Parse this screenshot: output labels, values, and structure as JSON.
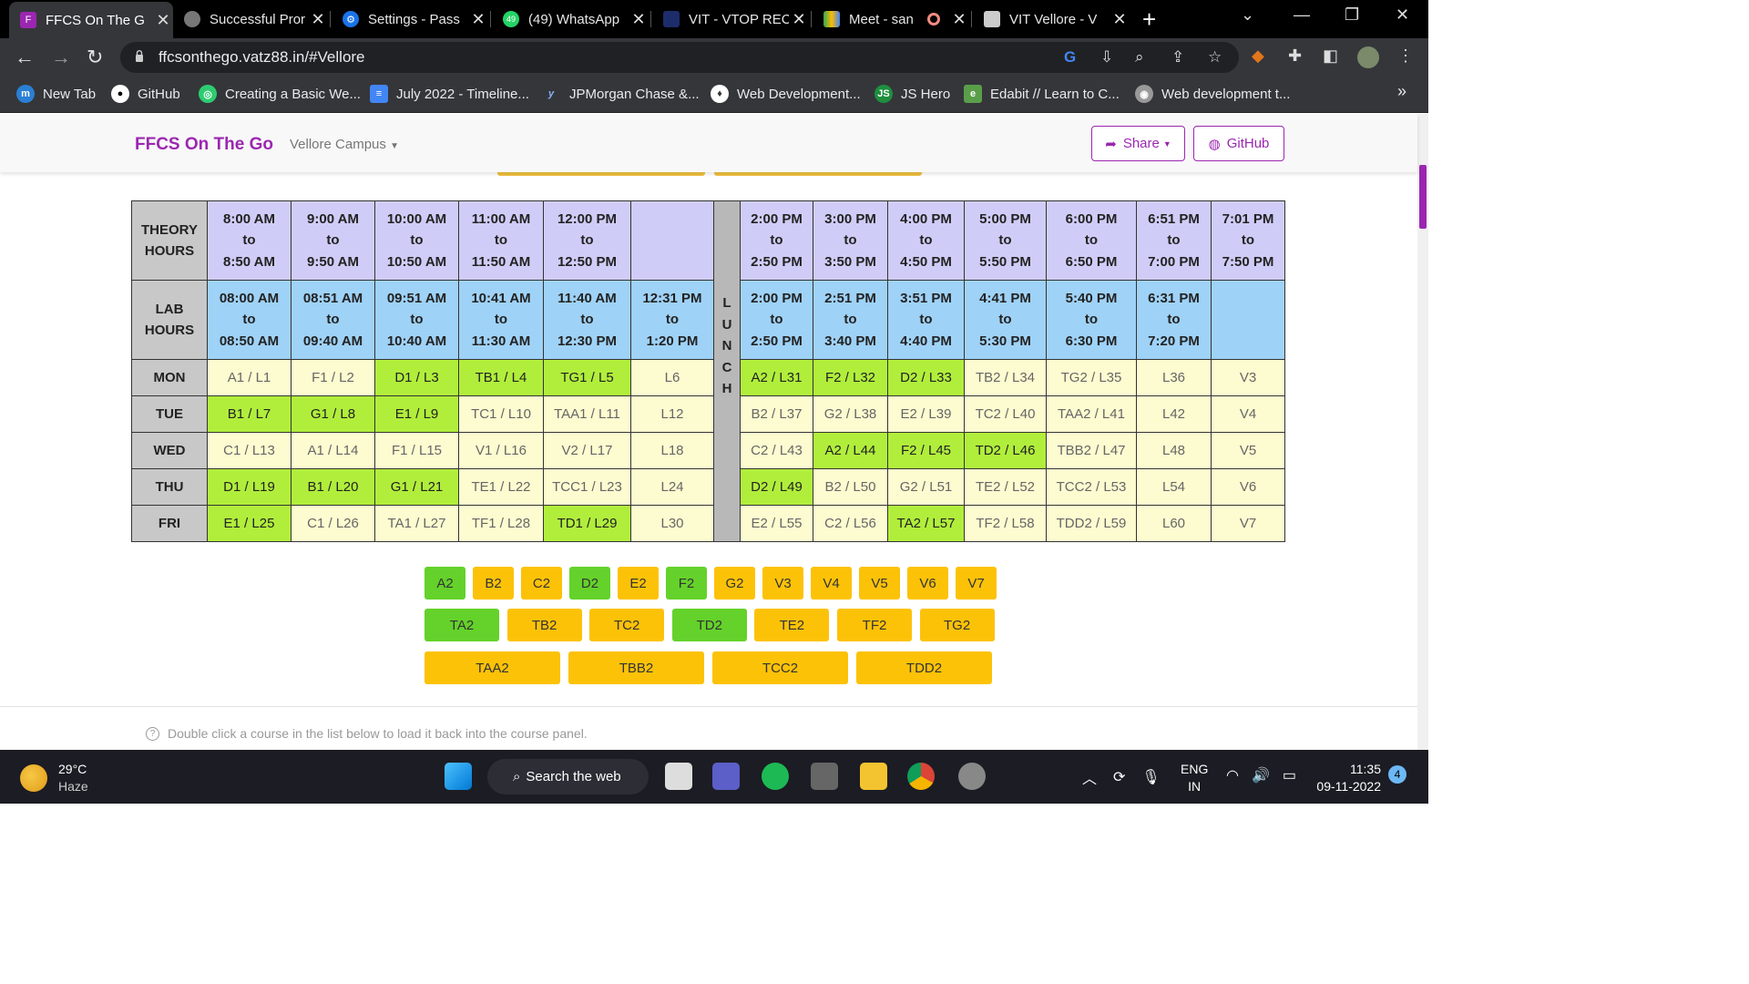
{
  "browser": {
    "tabs": [
      {
        "title": "FFCS On The G",
        "active": true
      },
      {
        "title": "Successful Pror",
        "active": false
      },
      {
        "title": "Settings - Pass",
        "active": false
      },
      {
        "title": "(49) WhatsApp",
        "active": false
      },
      {
        "title": "VIT - VTOP REC",
        "active": false
      },
      {
        "title": "Meet - san",
        "active": false
      },
      {
        "title": "VIT Vellore - V",
        "active": false
      }
    ],
    "whatsapp_badge": "49",
    "url": "ffcsonthego.vatz88.in/#Vellore",
    "bookmarks": [
      {
        "label": "New Tab",
        "icon": "m"
      },
      {
        "label": "GitHub",
        "icon": "github-icon"
      },
      {
        "label": "Creating a Basic We...",
        "icon": "swirl-icon"
      },
      {
        "label": "July 2022 - Timeline...",
        "icon": "doc-icon"
      },
      {
        "label": "JPMorgan Chase &...",
        "icon": "yello-icon"
      },
      {
        "label": "Web Development...",
        "icon": "bulb-icon"
      },
      {
        "label": "JS Hero",
        "icon": "js-icon"
      },
      {
        "label": "Edabit // Learn to C...",
        "icon": "edabit-icon"
      },
      {
        "label": "Web development t...",
        "icon": "globe-icon"
      }
    ],
    "bookmarks_overflow": "»"
  },
  "site": {
    "brand": "FFCS On The Go",
    "campus": "Vellore Campus",
    "share_label": "Share",
    "github_label": "GitHub"
  },
  "timetable": {
    "theory_label": [
      "THEORY",
      "HOURS"
    ],
    "lab_label": [
      "LAB",
      "HOURS"
    ],
    "lunch": [
      "L",
      "U",
      "N",
      "C",
      "H"
    ],
    "theory_hours": [
      [
        "8:00 AM",
        "to",
        "8:50 AM"
      ],
      [
        "9:00 AM",
        "to",
        "9:50 AM"
      ],
      [
        "10:00 AM",
        "to",
        "10:50 AM"
      ],
      [
        "11:00 AM",
        "to",
        "11:50 AM"
      ],
      [
        "12:00 PM",
        "to",
        "12:50 PM"
      ],
      [
        "",
        "",
        ""
      ],
      [
        "2:00 PM",
        "to",
        "2:50 PM"
      ],
      [
        "3:00 PM",
        "to",
        "3:50 PM"
      ],
      [
        "4:00 PM",
        "to",
        "4:50 PM"
      ],
      [
        "5:00 PM",
        "to",
        "5:50 PM"
      ],
      [
        "6:00 PM",
        "to",
        "6:50 PM"
      ],
      [
        "6:51 PM",
        "to",
        "7:00 PM"
      ],
      [
        "7:01 PM",
        "to",
        "7:50 PM"
      ]
    ],
    "lab_hours": [
      [
        "08:00 AM",
        "to",
        "08:50 AM"
      ],
      [
        "08:51 AM",
        "to",
        "09:40 AM"
      ],
      [
        "09:51 AM",
        "to",
        "10:40 AM"
      ],
      [
        "10:41 AM",
        "to",
        "11:30 AM"
      ],
      [
        "11:40 AM",
        "to",
        "12:30 PM"
      ],
      [
        "12:31 PM",
        "to",
        "1:20 PM"
      ],
      [
        "2:00 PM",
        "to",
        "2:50 PM"
      ],
      [
        "2:51 PM",
        "to",
        "3:40 PM"
      ],
      [
        "3:51 PM",
        "to",
        "4:40 PM"
      ],
      [
        "4:41 PM",
        "to",
        "5:30 PM"
      ],
      [
        "5:40 PM",
        "to",
        "6:30 PM"
      ],
      [
        "6:31 PM",
        "to",
        "7:20 PM"
      ],
      [
        "",
        "",
        ""
      ]
    ],
    "days": [
      {
        "day": "MON",
        "slots": [
          {
            "t": "A1 / L1",
            "sel": false
          },
          {
            "t": "F1 / L2",
            "sel": false
          },
          {
            "t": "D1 / L3",
            "sel": true
          },
          {
            "t": "TB1 / L4",
            "sel": true
          },
          {
            "t": "TG1 / L5",
            "sel": true
          },
          {
            "t": "L6",
            "sel": false
          },
          {
            "t": "A2 / L31",
            "sel": true
          },
          {
            "t": "F2 / L32",
            "sel": true
          },
          {
            "t": "D2 / L33",
            "sel": true
          },
          {
            "t": "TB2 / L34",
            "sel": false
          },
          {
            "t": "TG2 / L35",
            "sel": false
          },
          {
            "t": "L36",
            "sel": false
          },
          {
            "t": "V3",
            "sel": false
          }
        ]
      },
      {
        "day": "TUE",
        "slots": [
          {
            "t": "B1 / L7",
            "sel": true
          },
          {
            "t": "G1 / L8",
            "sel": true
          },
          {
            "t": "E1 / L9",
            "sel": true
          },
          {
            "t": "TC1 / L10",
            "sel": false
          },
          {
            "t": "TAA1 / L11",
            "sel": false
          },
          {
            "t": "L12",
            "sel": false
          },
          {
            "t": "B2 / L37",
            "sel": false
          },
          {
            "t": "G2 / L38",
            "sel": false
          },
          {
            "t": "E2 / L39",
            "sel": false
          },
          {
            "t": "TC2 / L40",
            "sel": false
          },
          {
            "t": "TAA2 / L41",
            "sel": false
          },
          {
            "t": "L42",
            "sel": false
          },
          {
            "t": "V4",
            "sel": false
          }
        ]
      },
      {
        "day": "WED",
        "slots": [
          {
            "t": "C1 / L13",
            "sel": false
          },
          {
            "t": "A1 / L14",
            "sel": false
          },
          {
            "t": "F1 / L15",
            "sel": false
          },
          {
            "t": "V1 / L16",
            "sel": false
          },
          {
            "t": "V2 / L17",
            "sel": false
          },
          {
            "t": "L18",
            "sel": false
          },
          {
            "t": "C2 / L43",
            "sel": false
          },
          {
            "t": "A2 / L44",
            "sel": true
          },
          {
            "t": "F2 / L45",
            "sel": true
          },
          {
            "t": "TD2 / L46",
            "sel": true
          },
          {
            "t": "TBB2 / L47",
            "sel": false
          },
          {
            "t": "L48",
            "sel": false
          },
          {
            "t": "V5",
            "sel": false
          }
        ]
      },
      {
        "day": "THU",
        "slots": [
          {
            "t": "D1 / L19",
            "sel": true
          },
          {
            "t": "B1 / L20",
            "sel": true
          },
          {
            "t": "G1 / L21",
            "sel": true
          },
          {
            "t": "TE1 / L22",
            "sel": false
          },
          {
            "t": "TCC1 / L23",
            "sel": false
          },
          {
            "t": "L24",
            "sel": false
          },
          {
            "t": "D2 / L49",
            "sel": true
          },
          {
            "t": "B2 / L50",
            "sel": false
          },
          {
            "t": "G2 / L51",
            "sel": false
          },
          {
            "t": "TE2 / L52",
            "sel": false
          },
          {
            "t": "TCC2 / L53",
            "sel": false
          },
          {
            "t": "L54",
            "sel": false
          },
          {
            "t": "V6",
            "sel": false
          }
        ]
      },
      {
        "day": "FRI",
        "slots": [
          {
            "t": "E1 / L25",
            "sel": true
          },
          {
            "t": "C1 / L26",
            "sel": false
          },
          {
            "t": "TA1 / L27",
            "sel": false
          },
          {
            "t": "TF1 / L28",
            "sel": false
          },
          {
            "t": "TD1 / L29",
            "sel": true
          },
          {
            "t": "L30",
            "sel": false
          },
          {
            "t": "E2 / L55",
            "sel": false
          },
          {
            "t": "C2 / L56",
            "sel": false
          },
          {
            "t": "TA2 / L57",
            "sel": true
          },
          {
            "t": "TF2 / L58",
            "sel": false
          },
          {
            "t": "TDD2 / L59",
            "sel": false
          },
          {
            "t": "L60",
            "sel": false
          },
          {
            "t": "V7",
            "sel": false
          }
        ]
      }
    ]
  },
  "slot_buttons": {
    "row1": [
      {
        "label": "A2",
        "on": true
      },
      {
        "label": "B2",
        "on": false
      },
      {
        "label": "C2",
        "on": false
      },
      {
        "label": "D2",
        "on": true
      },
      {
        "label": "E2",
        "on": false
      },
      {
        "label": "F2",
        "on": true
      },
      {
        "label": "G2",
        "on": false
      },
      {
        "label": "V3",
        "on": false
      },
      {
        "label": "V4",
        "on": false
      },
      {
        "label": "V5",
        "on": false
      },
      {
        "label": "V6",
        "on": false
      },
      {
        "label": "V7",
        "on": false
      }
    ],
    "row2": [
      {
        "label": "TA2",
        "on": true
      },
      {
        "label": "TB2",
        "on": false
      },
      {
        "label": "TC2",
        "on": false
      },
      {
        "label": "TD2",
        "on": true
      },
      {
        "label": "TE2",
        "on": false
      },
      {
        "label": "TF2",
        "on": false
      },
      {
        "label": "TG2",
        "on": false
      }
    ],
    "row3": [
      {
        "label": "TAA2",
        "on": false
      },
      {
        "label": "TBB2",
        "on": false
      },
      {
        "label": "TCC2",
        "on": false
      },
      {
        "label": "TDD2",
        "on": false
      }
    ]
  },
  "hint": "Double click a course in the list below to load it back into the course panel.",
  "taskbar": {
    "temperature": "29°C",
    "condition": "Haze",
    "search_label": "Search the web",
    "lang_line1": "ENG",
    "lang_line2": "IN",
    "time": "11:35",
    "date": "09-11-2022",
    "notifications": "4"
  },
  "colors": {
    "brand": "#9b27b0",
    "theory_header": "#cfcdf7",
    "lab_header": "#9fd2f7",
    "slot_free": "#fdfbd0",
    "slot_selected": "#b1ee3c",
    "button_on": "#64d22a",
    "button_off": "#fcc208"
  }
}
